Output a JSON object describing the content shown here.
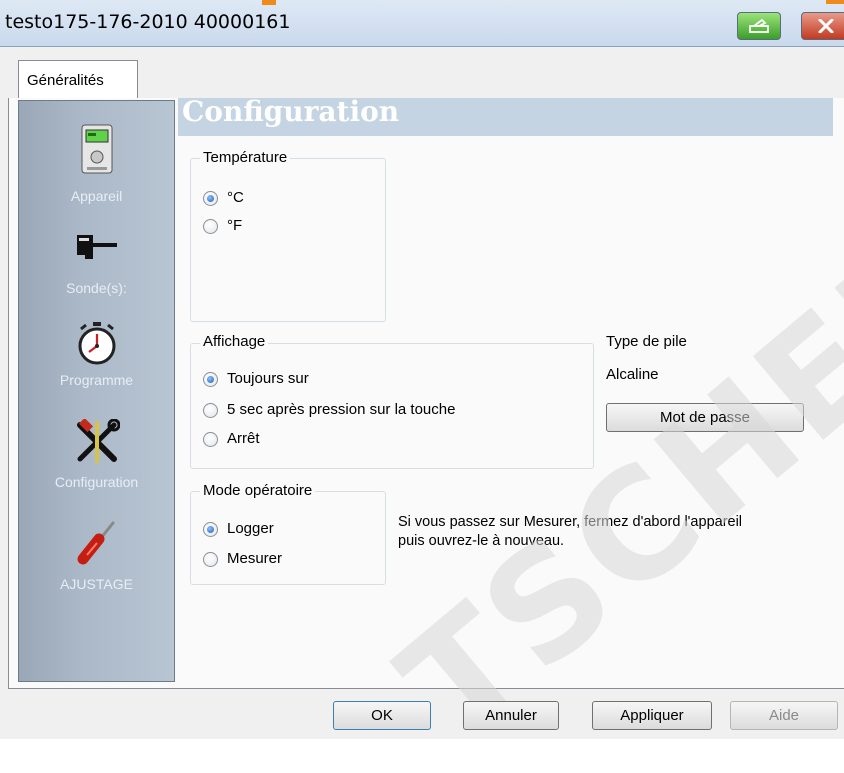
{
  "window": {
    "title": "testo175-176-2010 40000161"
  },
  "tabs": [
    {
      "label": "Généralités"
    }
  ],
  "sidebar": {
    "items": [
      {
        "label": "Appareil",
        "icon": "device-icon"
      },
      {
        "label": "Sonde(s):",
        "icon": "probe-icon"
      },
      {
        "label": "Programme",
        "icon": "stopwatch-icon"
      },
      {
        "label": "Configuration",
        "icon": "tools-icon"
      },
      {
        "label": "AJUSTAGE",
        "icon": "screwdriver-icon"
      }
    ]
  },
  "main": {
    "title": "Configuration",
    "temperature": {
      "legend": "Température",
      "options": [
        {
          "label": "°C",
          "selected": true
        },
        {
          "label": "°F",
          "selected": false
        }
      ]
    },
    "display": {
      "legend": "Affichage",
      "options": [
        {
          "label": "Toujours sur",
          "selected": true
        },
        {
          "label": "5 sec après pression sur la touche",
          "selected": false
        },
        {
          "label": "Arrêt",
          "selected": false
        }
      ]
    },
    "battery": {
      "label": "Type de pile",
      "value": "Alcaline"
    },
    "password_button": "Mot de passe",
    "mode": {
      "legend": "Mode opératoire",
      "options": [
        {
          "label": "Logger",
          "selected": true
        },
        {
          "label": "Mesurer",
          "selected": false
        }
      ]
    },
    "mode_note_line1": "Si vous passez sur Mesurer, fermez d'abord l'appareil",
    "mode_note_line2": "puis ouvrez-le à nouveau."
  },
  "footer": {
    "ok": "OK",
    "cancel": "Annuler",
    "apply": "Appliquer",
    "help": "Aide"
  },
  "watermark": "TSCHER",
  "colors": {
    "sidebar": "#aab8c7",
    "header_band": "#c5d4e2",
    "radio_selected": "#1b5fb8",
    "title_button_green": "#3b9e2b",
    "title_button_red": "#c23a22"
  }
}
